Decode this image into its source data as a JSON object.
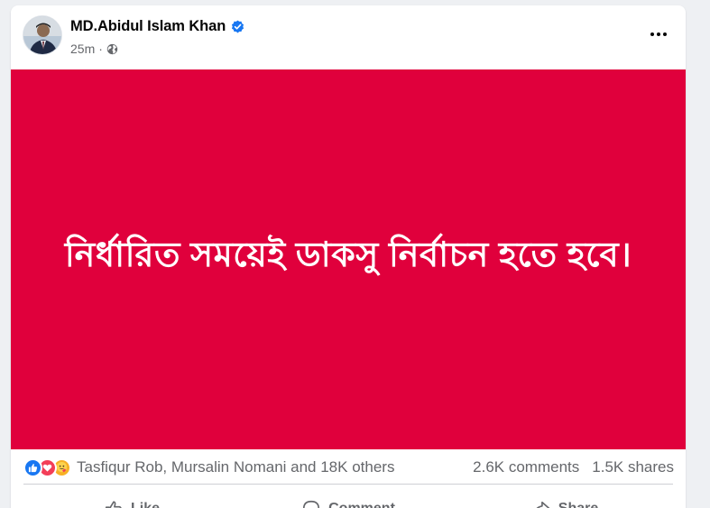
{
  "colors": {
    "post_background": "#e0003c",
    "post_text": "#ffffff",
    "name_text": "#050505",
    "secondary_text": "#65676b",
    "verified": "#1877f2",
    "like_reaction": "#1877f2",
    "love_reaction": "#f33e58",
    "care_reaction": "#f7b125"
  },
  "post": {
    "author_name": "MD.Abidul Islam Khan",
    "time": "25m",
    "separator": "·",
    "privacy_icon": "globe-icon",
    "text": "নির্ধারিত সময়েই ডাকসু নির্বাচন হতে হবে।"
  },
  "stats": {
    "reaction_icons": [
      "like-reaction-icon",
      "love-reaction-icon",
      "care-reaction-icon"
    ],
    "reactors": "Tasfiqur Rob, Mursalin Nomani and 18K others",
    "comments": "2.6K comments",
    "shares": "1.5K shares"
  },
  "actions": {
    "like": "Like",
    "comment": "Comment",
    "share": "Share"
  }
}
